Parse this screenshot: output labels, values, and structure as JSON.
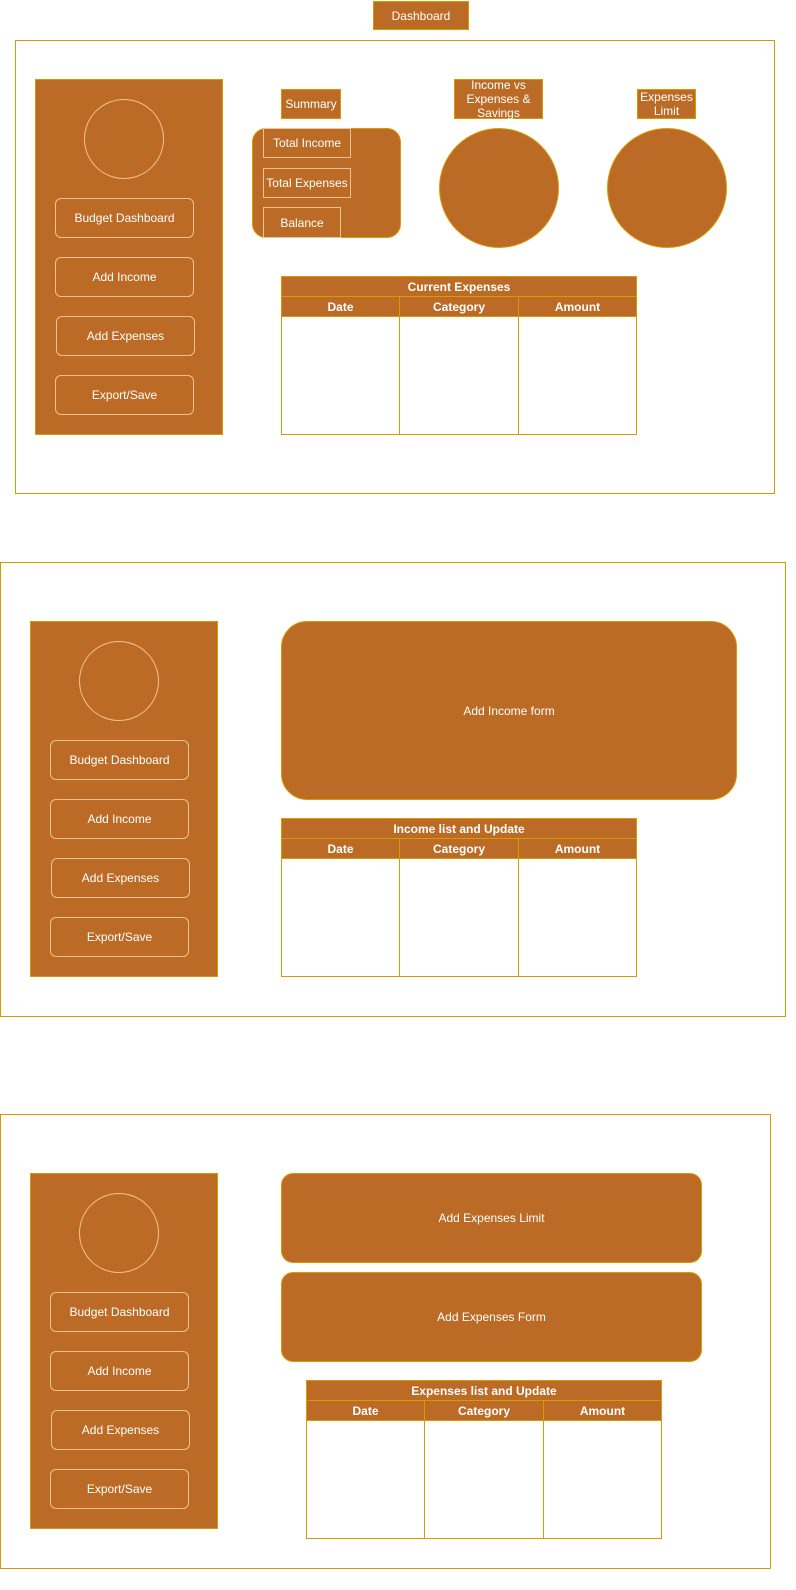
{
  "header": {
    "title": "Dashboard"
  },
  "sidebar": {
    "items": [
      {
        "label": "Budget Dashboard"
      },
      {
        "label": "Add Income"
      },
      {
        "label": "Add Expenses"
      },
      {
        "label": "Export/Save"
      }
    ]
  },
  "dashboard": {
    "summary_title": "Summary",
    "summary_items": [
      "Total Income",
      "Total Expenses",
      "Balance"
    ],
    "income_chart_label": "Income vs Expenses & Savings",
    "limit_chart_label": "Expenses Limit",
    "table": {
      "title": "Current Expenses",
      "columns": [
        "Date",
        "Category",
        "Amount"
      ]
    }
  },
  "income_page": {
    "form_label": "Add Income form",
    "table": {
      "title": "Income list and Update",
      "columns": [
        "Date",
        "Category",
        "Amount"
      ]
    }
  },
  "expenses_page": {
    "limit_label": "Add Expenses Limit",
    "form_label": "Add Expenses Form",
    "table": {
      "title": "Expenses list and Update",
      "columns": [
        "Date",
        "Category",
        "Amount"
      ]
    }
  },
  "colors": {
    "fill": "#BC6B26",
    "stroke": "#D79B00",
    "inner_stroke": "#F1C291",
    "text": "#FFFFFF"
  }
}
